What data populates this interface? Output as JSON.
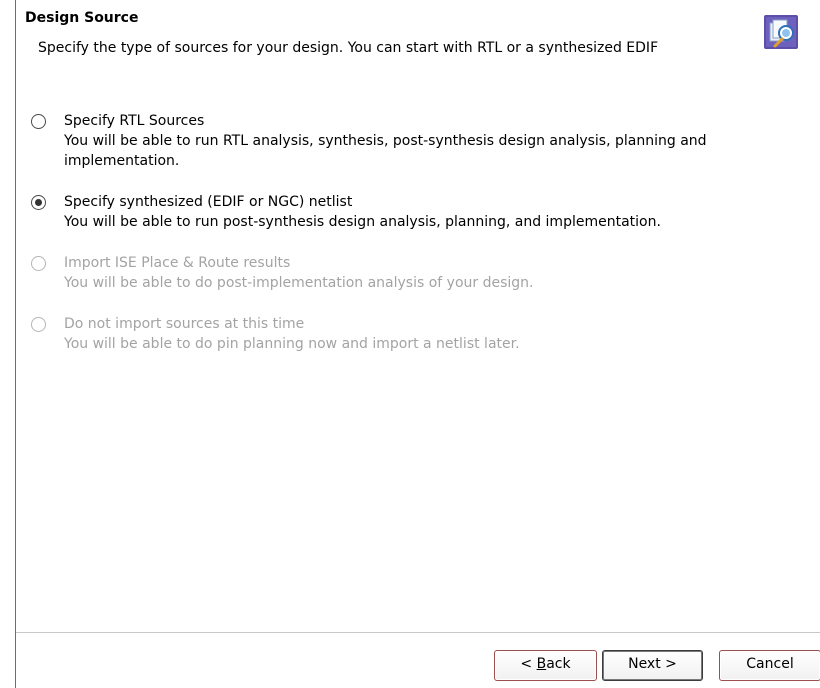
{
  "header": {
    "title": "Design Source",
    "description": "Specify the type of sources for your design. You can start with RTL or a synthesized EDIF",
    "icon": "wizard-sources-icon"
  },
  "options": [
    {
      "title": "Specify RTL Sources",
      "description": "You will be able to run RTL analysis, synthesis, post-synthesis design analysis, planning and implementation.",
      "selected": false,
      "enabled": true
    },
    {
      "title": "Specify synthesized (EDIF or NGC) netlist",
      "description": "You will be able to run post-synthesis design analysis, planning, and implementation.",
      "selected": true,
      "enabled": true
    },
    {
      "title": "Import ISE Place & Route results",
      "description": "You will be able to do post-implementation analysis of your design.",
      "selected": false,
      "enabled": false
    },
    {
      "title": "Do not import sources at this time",
      "description": "You will be able to do pin planning now and import a netlist later.",
      "selected": false,
      "enabled": false
    }
  ],
  "footer": {
    "back_prefix": "< ",
    "back_mnemonic": "B",
    "back_rest": "ack",
    "next_label": "Next >",
    "cancel_label": "Cancel"
  }
}
